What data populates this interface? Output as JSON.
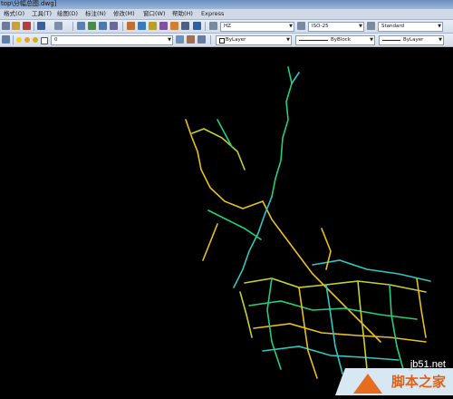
{
  "window": {
    "title": "top\\分幅总图.dwg]"
  },
  "menu": {
    "items": [
      "格式(O)",
      "工具(T)",
      "绘图(D)",
      "标注(N)",
      "修改(M)",
      "窗口(W)",
      "帮助(H)",
      "Express"
    ]
  },
  "toolbar1": {
    "text_style": "HZ",
    "dim_style": "ISO-25",
    "table_style": "Standard"
  },
  "toolbar2": {
    "layer": "0",
    "color": "ByLayer",
    "linetype": "ByBlock",
    "lineweight": "ByLayer"
  },
  "watermark": {
    "site": "jb51.net",
    "brand": "脚本之家"
  },
  "colors": {
    "canvas": "#000000",
    "road_green": "#22d07a",
    "road_yellow": "#e8c020",
    "road_cyan": "#30c8c0",
    "watermark_orange": "#e06018"
  }
}
